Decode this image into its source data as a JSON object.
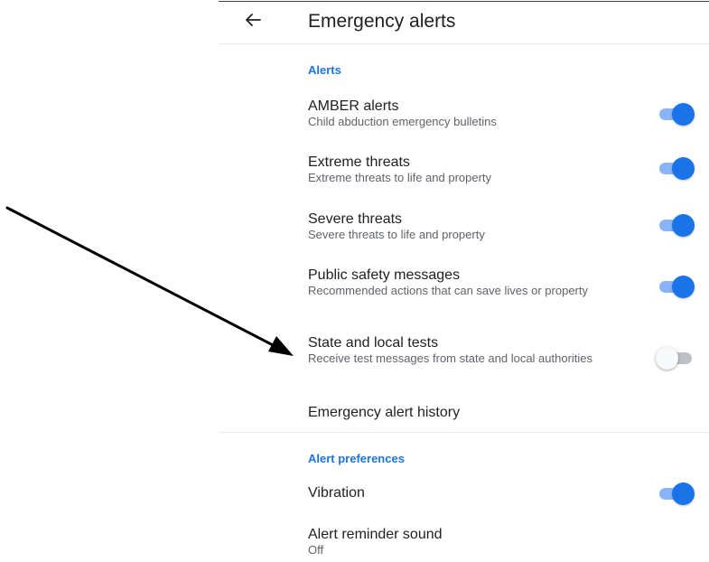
{
  "header": {
    "title": "Emergency alerts",
    "back_icon": "arrow-back-icon"
  },
  "sections": {
    "alerts": {
      "label": "Alerts"
    },
    "preferences": {
      "label": "Alert preferences"
    }
  },
  "settings": [
    {
      "title": "AMBER alerts",
      "subtitle": "Child abduction emergency bulletins",
      "enabled": true
    },
    {
      "title": "Extreme threats",
      "subtitle": "Extreme threats to life and property",
      "enabled": true
    },
    {
      "title": "Severe threats",
      "subtitle": "Severe threats to life and property",
      "enabled": true
    },
    {
      "title": "Public safety messages",
      "subtitle": "Recommended actions that can save lives or property",
      "enabled": true
    },
    {
      "title": "State and local tests",
      "subtitle": "Receive test messages from state and local authorities",
      "enabled": false
    },
    {
      "title": "Emergency alert history"
    },
    {
      "title": "Vibration",
      "enabled": true
    },
    {
      "title": "Alert reminder sound",
      "subtitle": "Off"
    }
  ],
  "colors": {
    "accent": "#1a73e8",
    "switch_track_on": "#8ab4f8",
    "switch_track_off": "#bdc1c6",
    "text_primary": "#202124",
    "text_secondary": "#5f6368"
  }
}
